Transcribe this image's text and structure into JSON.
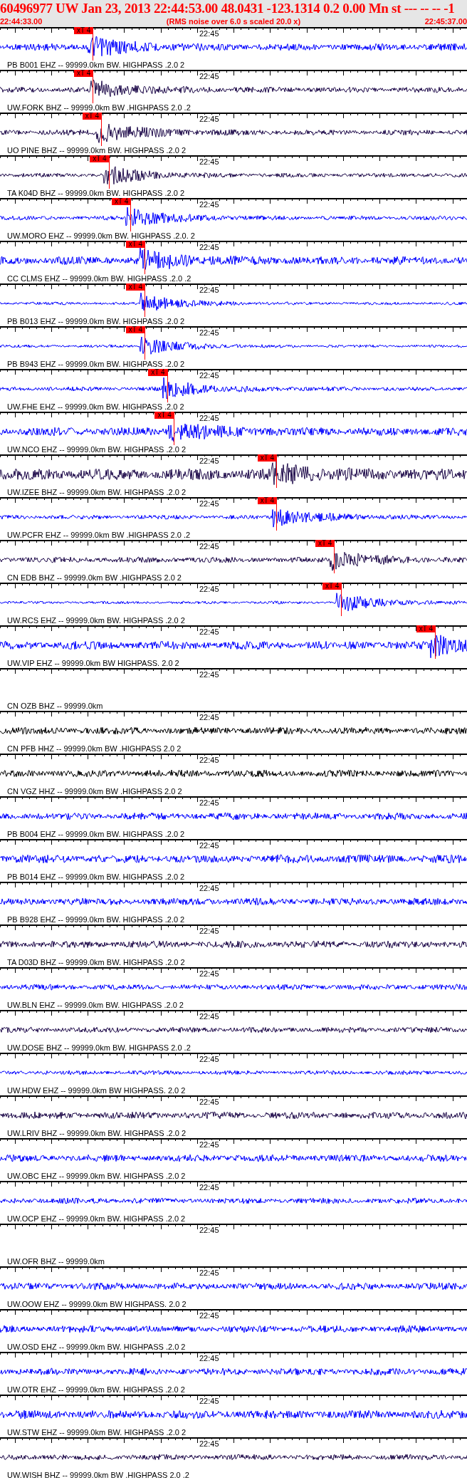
{
  "header": {
    "title": "60496977 UW Jan 23, 2013 22:44:53.00   48.0431 -123.1314  0.2 0.00 Mn st --- -- --  -1",
    "start_time": "22:44:33.00",
    "note": "(RMS noise over 6.0 s scaled 20.0 x)",
    "end_time": "22:45:37.00"
  },
  "traces": [
    {
      "kind": "waveform",
      "color": "#0000ff",
      "time_label": "22:45",
      "label": "PB B001 EHZ -- 99999.0km BW. HIGHPASS .2.0 2",
      "pick": {
        "label": "xT 4",
        "level": 0.2
      }
    },
    {
      "kind": "waveform",
      "color": "#1e0a4a",
      "time_label": "22:45",
      "label": "UW.FORK BHZ -- 99999.0km BW .HIGHPASS  2.0 .2",
      "pick": {
        "label": "xT 4",
        "level": 0.2
      }
    },
    {
      "kind": "waveform",
      "color": "#1e0a4a",
      "time_label": "22:45",
      "label": "UO PINE BHZ -- 99999.0km BW. HIGHPASS .2.0 2",
      "pick": {
        "label": "xT 4",
        "level": 0.218
      }
    },
    {
      "kind": "waveform",
      "color": "#1e0a4a",
      "time_label": "22:45",
      "label": "TA K04D BHZ -- 99999.0km BW. HIGHPASS .2.0 2",
      "pick": {
        "label": "xT 4",
        "level": 0.234
      }
    },
    {
      "kind": "waveform",
      "color": "#0000ff",
      "time_label": "22:45",
      "label": "UW.MORO EHZ -- 99999.0km BW. HIGHPASS .2.0. 2",
      "pick": {
        "label": "xT 4",
        "level": 0.281
      }
    },
    {
      "kind": "waveform",
      "color": "#0000ff",
      "time_label": "22:45",
      "label": "CC CLMS EHZ -- 99999.0km BW. HIGHPASS .2.0 .2",
      "pick": {
        "label": "xT 4",
        "level": 0.311
      }
    },
    {
      "kind": "waveform",
      "color": "#0000ff",
      "time_label": "22:45",
      "label": "PB B013 EHZ -- 99999.0km BW. HIGHPASS .2.0 2",
      "pick": {
        "label": "xT 4",
        "level": 0.311
      }
    },
    {
      "kind": "waveform",
      "color": "#0000ff",
      "time_label": "22:45",
      "label": "PB B943 EHZ -- 99999.0km BW. HIGHPASS .2.0 2",
      "pick": {
        "label": "xT 4",
        "level": 0.311
      }
    },
    {
      "kind": "waveform",
      "color": "#0000ff",
      "time_label": "22:45",
      "label": "UW.FHE EHZ -- 99999.0km BW. HIGHPASS .2.0 2",
      "pick": {
        "label": "xT 4",
        "level": 0.359
      }
    },
    {
      "kind": "waveform",
      "color": "#0000ff",
      "time_label": "22:45",
      "label": "UW.NCO EHZ -- 99999.0km BW. HIGHPASS .2.0 2",
      "pick": {
        "label": "xT 4",
        "level": 0.373
      }
    },
    {
      "kind": "waveform",
      "color": "#1e0a4a",
      "time_label": "22:45",
      "label": "UW.IZEE BHZ -- 99999.0km BW. HIGHPASS .2.0 2",
      "pick": {
        "label": "xT 4",
        "level": 0.593
      }
    },
    {
      "kind": "waveform",
      "color": "#0000ff",
      "time_label": "22:45",
      "label": "UW.PCFR EHZ -- 99999.0km BW .HIGHPASS  2.0 .2",
      "pick": {
        "label": "xT 4",
        "level": 0.593
      }
    },
    {
      "kind": "waveform",
      "color": "#1e0a4a",
      "time_label": "22:45",
      "label": "CN EDB BHZ -- 99999.0km BW .HIGHPASS  2.0 2",
      "pick": {
        "label": "xT 4",
        "level": 0.717
      }
    },
    {
      "kind": "waveform",
      "color": "#0000ff",
      "time_label": "22:45",
      "label": "UW.RCS EHZ -- 99999.0km BW. HIGHPASS .2.0 2",
      "pick": {
        "label": "xT 4",
        "level": 0.732
      }
    },
    {
      "kind": "waveform",
      "color": "#0000ff",
      "time_label": "22:45",
      "label": "UW.VIP EHZ -- 99999.0km BW  HIGHPASS. 2.0  2",
      "pick": {
        "label": "xT 4",
        "level": 0.933
      }
    },
    {
      "kind": "blank",
      "time_label": "22:45",
      "label": "CN OZB BHZ -- 99999.0km"
    },
    {
      "kind": "waveform",
      "color": "#000000",
      "time_label": "22:45",
      "label": "CN PFB HHZ -- 99999.0km BW .HIGHPASS  2.0 2"
    },
    {
      "kind": "waveform",
      "color": "#000000",
      "time_label": "22:45",
      "label": "CN VGZ HHZ -- 99999.0km BW .HIGHPASS  2.0 2"
    },
    {
      "kind": "waveform",
      "color": "#0000ff",
      "time_label": "22:45",
      "label": "PB B004 EHZ -- 99999.0km BW. HIGHPASS .2.0 2"
    },
    {
      "kind": "waveform",
      "color": "#0000ff",
      "time_label": "22:45",
      "label": "PB B014 EHZ -- 99999.0km BW. HIGHPASS .2.0 2"
    },
    {
      "kind": "waveform",
      "color": "#0000ff",
      "time_label": "22:45",
      "label": "PB B928 EHZ -- 99999.0km BW. HIGHPASS .2.0 2"
    },
    {
      "kind": "waveform",
      "color": "#1e0a4a",
      "time_label": "22:45",
      "label": "TA D03D BHZ -- 99999.0km BW. HIGHPASS .2.0 2"
    },
    {
      "kind": "waveform",
      "color": "#0000ff",
      "time_label": "22:45",
      "label": "UW.BLN EHZ -- 99999.0km BW. HIGHPASS .2.0 2"
    },
    {
      "kind": "waveform",
      "color": "#1e0a4a",
      "time_label": "22:45",
      "label": "UW.DOSE BHZ -- 99999.0km BW. HIGHPASS  2.0 .2"
    },
    {
      "kind": "waveform",
      "color": "#0000ff",
      "time_label": "22:45",
      "label": "UW.HDW EHZ -- 99999.0km BW  HIGHPASS. 2.0  2"
    },
    {
      "kind": "waveform",
      "color": "#1e0a4a",
      "time_label": "22:45",
      "label": "UW.LRIV BHZ -- 99999.0km BW. HIGHPASS .2.0 2"
    },
    {
      "kind": "waveform",
      "color": "#0000ff",
      "time_label": "22:45",
      "label": "UW.OBC EHZ -- 99999.0km BW. HIGHPASS .2.0 2"
    },
    {
      "kind": "waveform",
      "color": "#0000ff",
      "time_label": "22:45",
      "label": "UW.OCP EHZ -- 99999.0km BW. HIGHPASS .2.0 2"
    },
    {
      "kind": "blank",
      "time_label": "22:45",
      "label": "UW.OFR BHZ -- 99999.0km"
    },
    {
      "kind": "waveform",
      "color": "#0000ff",
      "time_label": "22:45",
      "label": "UW.OOW EHZ -- 99999.0km BW  HIGHPASS. 2.0  2"
    },
    {
      "kind": "waveform",
      "color": "#0000ff",
      "time_label": "22:45",
      "label": "UW.OSD EHZ -- 99999.0km BW. HIGHPASS .2.0 2"
    },
    {
      "kind": "waveform",
      "color": "#0000ff",
      "time_label": "22:45",
      "label": "UW.OTR EHZ -- 99999.0km BW. HIGHPASS .2.0 2"
    },
    {
      "kind": "waveform",
      "color": "#0000ff",
      "time_label": "22:45",
      "label": "UW.STW EHZ -- 99999.0km BW. HIGHPASS .2.0 2"
    },
    {
      "kind": "waveform",
      "color": "#1e0a4a",
      "time_label": "22:45",
      "label": "UW.WISH BHZ -- 99999.0km BW .HIGHPASS  2.0 .2"
    }
  ]
}
